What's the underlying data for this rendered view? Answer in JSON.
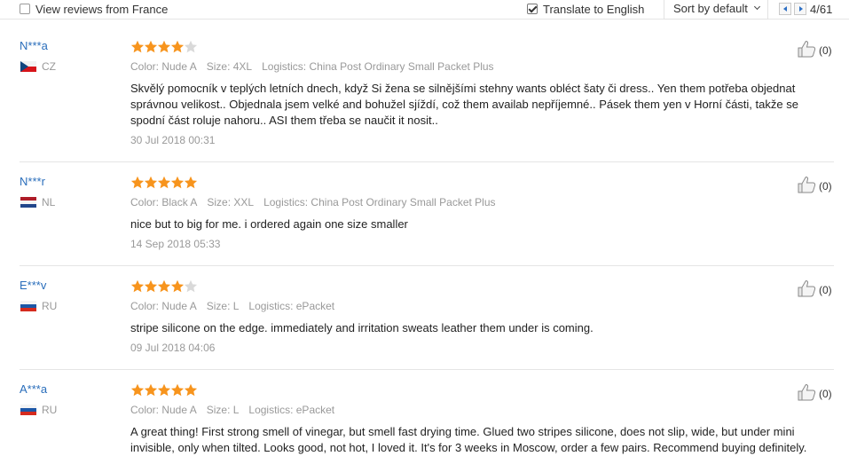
{
  "toolbar": {
    "view_france_label": "View reviews from France",
    "view_france_checked": false,
    "translate_label": "Translate to English",
    "translate_checked": true,
    "sort_label": "Sort by default",
    "page_count": "4/61"
  },
  "reviews": [
    {
      "user": "N***a",
      "country": "CZ",
      "rating": 4,
      "color": "Color: Nude A",
      "size": "Size: 4XL",
      "logistics": "Logistics: China Post Ordinary Small Packet Plus",
      "text_lines": [
        "Skvělý pomocník v teplých letních dnech, když Si žena se silnějšími stehny wants obléct šaty či dress.. Yen them potřeba objednat",
        "správnou velikost.. Objednala jsem velké and bohužel sjíždí, což them availab nepříjemné.. Pásek them yen v Horní části, takže se",
        "spodní část roluje nahoru.. ASI them třeba se naučit it nosit.."
      ],
      "date": "30 Jul 2018 00:31",
      "helpful_count": "(0)"
    },
    {
      "user": "N***r",
      "country": "NL",
      "rating": 5,
      "color": "Color: Black A",
      "size": "Size: XXL",
      "logistics": "Logistics: China Post Ordinary Small Packet Plus",
      "text_lines": [
        "nice but to big for me. i ordered again one size smaller"
      ],
      "date": "14 Sep 2018 05:33",
      "helpful_count": "(0)"
    },
    {
      "user": "E***v",
      "country": "RU",
      "rating": 4,
      "color": "Color: Nude A",
      "size": "Size: L",
      "logistics": "Logistics: ePacket",
      "text_lines": [
        "stripe silicone on the edge. immediately and irritation sweats leather them under is coming."
      ],
      "date": "09 Jul 2018 04:06",
      "helpful_count": "(0)"
    },
    {
      "user": "A***a",
      "country": "RU",
      "rating": 5,
      "color": "Color: Nude A",
      "size": "Size: L",
      "logistics": "Logistics: ePacket",
      "text_lines": [
        "A great thing! First strong smell of vinegar, but smell fast drying time. Glued two stripes silicone, does not slip, wide, but under mini",
        "invisible, only when tilted. Looks good, not hot, I loved it. It's for 3 weeks in Moscow, order a few pairs. Recommend buying definitely."
      ],
      "date": "",
      "helpful_count": "(0)"
    }
  ],
  "colors": {
    "link": "#2a6ebb",
    "star": "#f7941d",
    "star_empty": "#d9d9d9",
    "muted": "#999999"
  }
}
